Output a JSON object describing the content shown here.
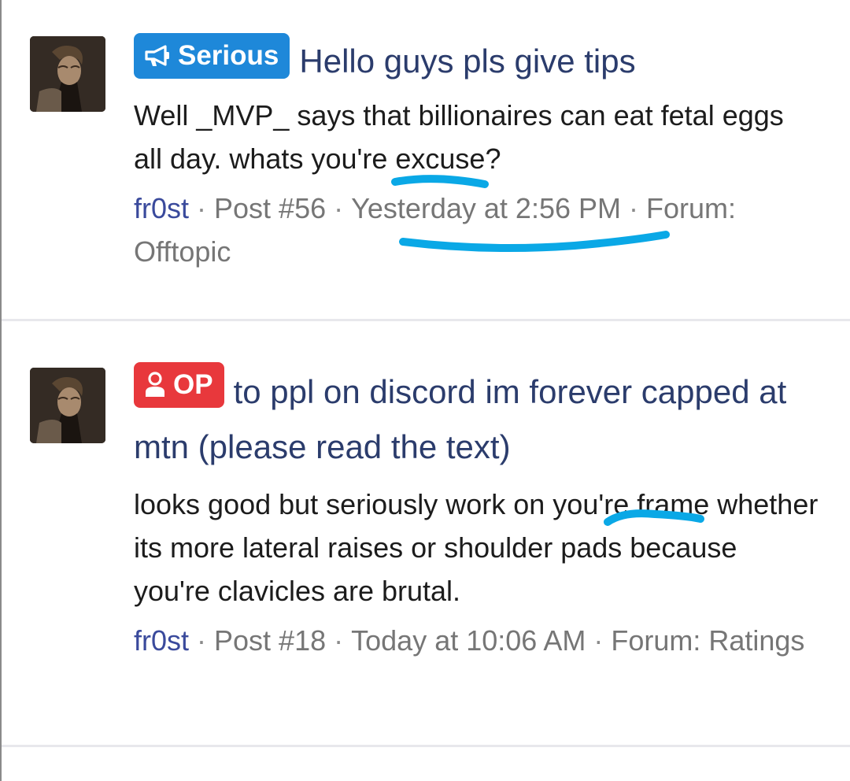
{
  "colors": {
    "serious_prefix": "#1e88d9",
    "op_prefix": "#e8383c",
    "title": "#2b3c6c",
    "author_link": "#3a4a9c",
    "meta": "#767676",
    "annotation": "#0aa8e6"
  },
  "results": [
    {
      "avatar_icon": "user-avatar",
      "prefix_icon": "megaphone-icon",
      "prefix_label": "Serious",
      "title": "Hello guys pls give tips",
      "snippet_before": "Well _MVP_ says that billionaires can eat fetal eggs all day. whats ",
      "snippet_highlight": "you're",
      "snippet_after": " excuse?",
      "author": "fr0st",
      "post": "Post #56",
      "date": "Yesterday at 2:56 PM",
      "forum_label": "Forum:",
      "forum": "Offtopic"
    },
    {
      "avatar_icon": "user-avatar",
      "prefix_icon": "person-icon",
      "prefix_label": "OP",
      "title": "to ppl on discord im forever capped at mtn (please read the text)",
      "snippet_before": "looks good but seriously work on ",
      "snippet_highlight": "you're",
      "snippet_after": " frame whether its more lateral raises or shoulder pads because you're clavicles are brutal.",
      "author": "fr0st",
      "post": "Post #18",
      "date": "Today at 10:06 AM",
      "forum_label": "Forum:",
      "forum": "Ratings"
    }
  ]
}
